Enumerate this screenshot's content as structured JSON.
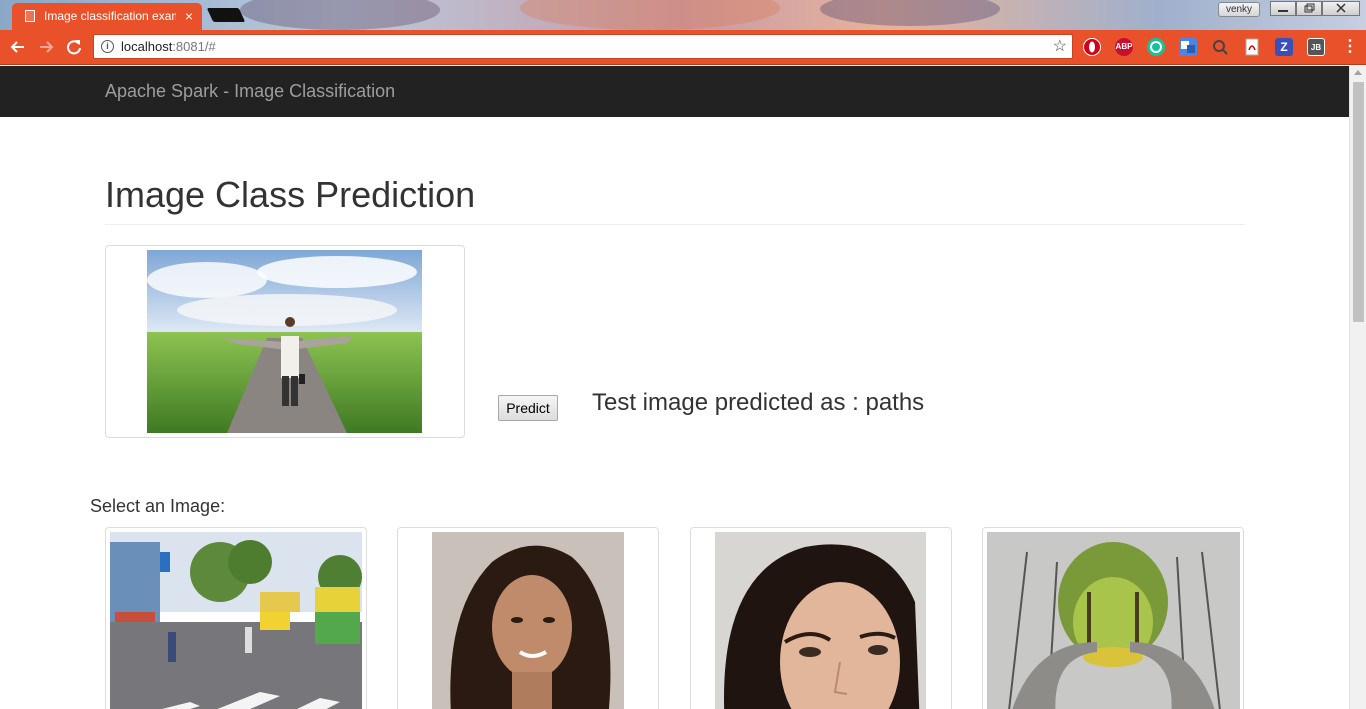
{
  "browser": {
    "tab_title": "Image classification exam",
    "tab_close": "×",
    "profile_name": "venky",
    "url_host": "localhost",
    "url_rest": ":8081/#",
    "ext_abp": "ABP",
    "ext_z": "Z",
    "ext_jb": "JB",
    "accent_color": "#e8512a"
  },
  "navbar": {
    "brand": "Apache Spark - Image Classification"
  },
  "main": {
    "title": "Image Class Prediction",
    "predict_label": "Predict",
    "result_text": "Test image predicted as : paths",
    "select_label": "Select an Image:"
  },
  "icons": [
    "document-icon",
    "close-icon",
    "back-icon",
    "forward-icon",
    "reload-icon",
    "info-icon",
    "star-icon",
    "menu-icon"
  ]
}
